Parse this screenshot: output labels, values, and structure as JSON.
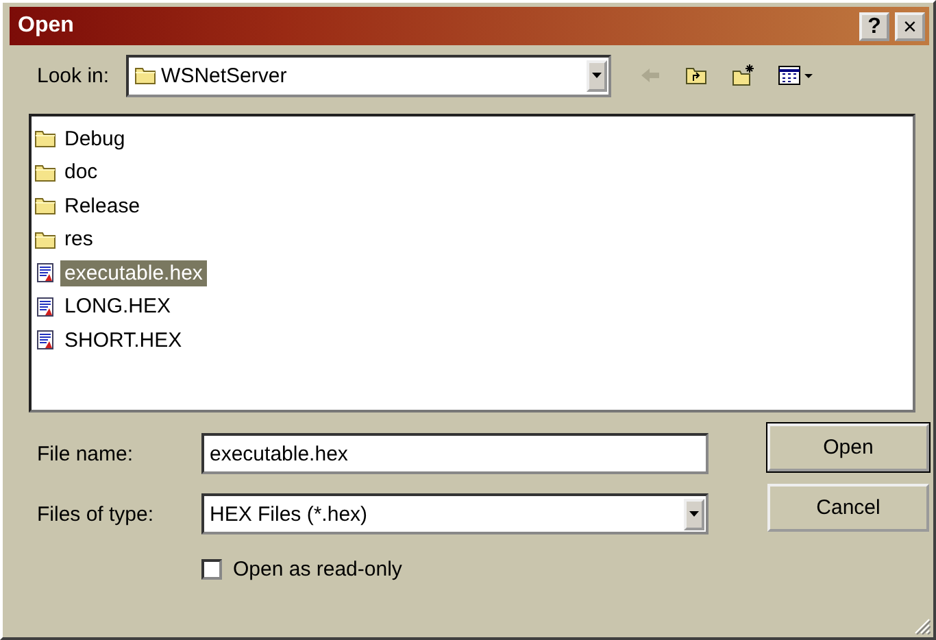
{
  "window": {
    "title": "Open",
    "title_buttons": [
      {
        "label": "?",
        "kind": "help"
      },
      {
        "label": "×",
        "kind": "close"
      }
    ]
  },
  "look_in": {
    "label": "Look in:",
    "value": "WSNetServer"
  },
  "toolbar": [
    {
      "kind": "back",
      "disabled": true
    },
    {
      "kind": "up",
      "disabled": false
    },
    {
      "kind": "new_folder",
      "disabled": false
    },
    {
      "kind": "views",
      "disabled": false
    }
  ],
  "files": [
    {
      "name": "Debug",
      "kind": "folder",
      "selected": false
    },
    {
      "name": "doc",
      "kind": "folder",
      "selected": false
    },
    {
      "name": "Release",
      "kind": "folder",
      "selected": false
    },
    {
      "name": "res",
      "kind": "folder",
      "selected": false
    },
    {
      "name": "executable.hex",
      "kind": "hex",
      "selected": true
    },
    {
      "name": "LONG.HEX",
      "kind": "hex",
      "selected": false
    },
    {
      "name": "SHORT.HEX",
      "kind": "hex",
      "selected": false
    }
  ],
  "file_name": {
    "label": "File name:",
    "value": "executable.hex"
  },
  "file_type": {
    "label": "Files of type:",
    "value": "HEX Files (*.hex)"
  },
  "buttons": [
    {
      "label": "Open",
      "default": true
    },
    {
      "label": "Cancel",
      "default": false
    }
  ],
  "read_only": {
    "label": "Open as read-only",
    "checked": false
  }
}
